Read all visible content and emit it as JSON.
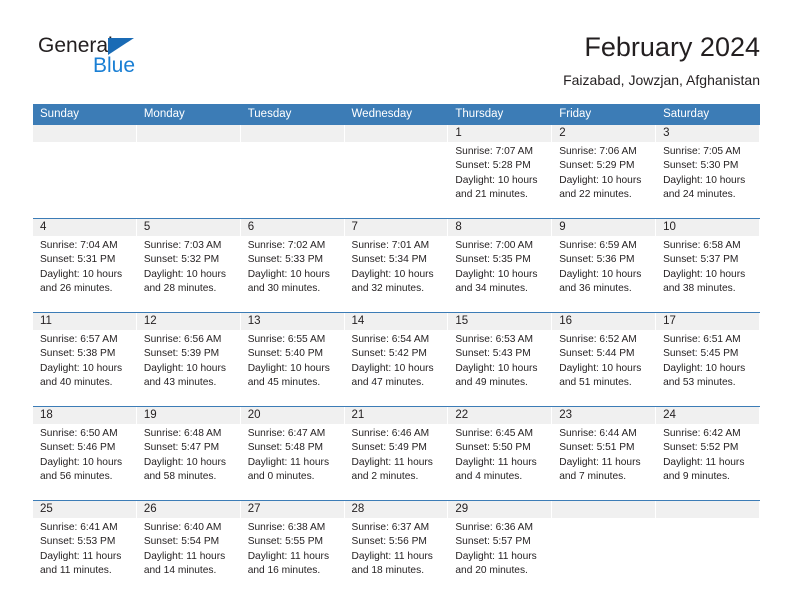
{
  "brand": {
    "name_part1": "General",
    "name_part2": "Blue",
    "triangle_color": "#1a6bb5",
    "blue_color": "#1a7fd4"
  },
  "header": {
    "title": "February 2024",
    "location": "Faizabad, Jowzjan, Afghanistan"
  },
  "theme": {
    "header_blue": "#3c7cb6",
    "daynum_gray": "#f0f0f0",
    "text": "#231f20"
  },
  "weekdays": [
    "Sunday",
    "Monday",
    "Tuesday",
    "Wednesday",
    "Thursday",
    "Friday",
    "Saturday"
  ],
  "weeks": [
    [
      {
        "day": "",
        "sunrise": "",
        "sunset": "",
        "daylight1": "",
        "daylight2": ""
      },
      {
        "day": "",
        "sunrise": "",
        "sunset": "",
        "daylight1": "",
        "daylight2": ""
      },
      {
        "day": "",
        "sunrise": "",
        "sunset": "",
        "daylight1": "",
        "daylight2": ""
      },
      {
        "day": "",
        "sunrise": "",
        "sunset": "",
        "daylight1": "",
        "daylight2": ""
      },
      {
        "day": "1",
        "sunrise": "Sunrise: 7:07 AM",
        "sunset": "Sunset: 5:28 PM",
        "daylight1": "Daylight: 10 hours",
        "daylight2": "and 21 minutes."
      },
      {
        "day": "2",
        "sunrise": "Sunrise: 7:06 AM",
        "sunset": "Sunset: 5:29 PM",
        "daylight1": "Daylight: 10 hours",
        "daylight2": "and 22 minutes."
      },
      {
        "day": "3",
        "sunrise": "Sunrise: 7:05 AM",
        "sunset": "Sunset: 5:30 PM",
        "daylight1": "Daylight: 10 hours",
        "daylight2": "and 24 minutes."
      }
    ],
    [
      {
        "day": "4",
        "sunrise": "Sunrise: 7:04 AM",
        "sunset": "Sunset: 5:31 PM",
        "daylight1": "Daylight: 10 hours",
        "daylight2": "and 26 minutes."
      },
      {
        "day": "5",
        "sunrise": "Sunrise: 7:03 AM",
        "sunset": "Sunset: 5:32 PM",
        "daylight1": "Daylight: 10 hours",
        "daylight2": "and 28 minutes."
      },
      {
        "day": "6",
        "sunrise": "Sunrise: 7:02 AM",
        "sunset": "Sunset: 5:33 PM",
        "daylight1": "Daylight: 10 hours",
        "daylight2": "and 30 minutes."
      },
      {
        "day": "7",
        "sunrise": "Sunrise: 7:01 AM",
        "sunset": "Sunset: 5:34 PM",
        "daylight1": "Daylight: 10 hours",
        "daylight2": "and 32 minutes."
      },
      {
        "day": "8",
        "sunrise": "Sunrise: 7:00 AM",
        "sunset": "Sunset: 5:35 PM",
        "daylight1": "Daylight: 10 hours",
        "daylight2": "and 34 minutes."
      },
      {
        "day": "9",
        "sunrise": "Sunrise: 6:59 AM",
        "sunset": "Sunset: 5:36 PM",
        "daylight1": "Daylight: 10 hours",
        "daylight2": "and 36 minutes."
      },
      {
        "day": "10",
        "sunrise": "Sunrise: 6:58 AM",
        "sunset": "Sunset: 5:37 PM",
        "daylight1": "Daylight: 10 hours",
        "daylight2": "and 38 minutes."
      }
    ],
    [
      {
        "day": "11",
        "sunrise": "Sunrise: 6:57 AM",
        "sunset": "Sunset: 5:38 PM",
        "daylight1": "Daylight: 10 hours",
        "daylight2": "and 40 minutes."
      },
      {
        "day": "12",
        "sunrise": "Sunrise: 6:56 AM",
        "sunset": "Sunset: 5:39 PM",
        "daylight1": "Daylight: 10 hours",
        "daylight2": "and 43 minutes."
      },
      {
        "day": "13",
        "sunrise": "Sunrise: 6:55 AM",
        "sunset": "Sunset: 5:40 PM",
        "daylight1": "Daylight: 10 hours",
        "daylight2": "and 45 minutes."
      },
      {
        "day": "14",
        "sunrise": "Sunrise: 6:54 AM",
        "sunset": "Sunset: 5:42 PM",
        "daylight1": "Daylight: 10 hours",
        "daylight2": "and 47 minutes."
      },
      {
        "day": "15",
        "sunrise": "Sunrise: 6:53 AM",
        "sunset": "Sunset: 5:43 PM",
        "daylight1": "Daylight: 10 hours",
        "daylight2": "and 49 minutes."
      },
      {
        "day": "16",
        "sunrise": "Sunrise: 6:52 AM",
        "sunset": "Sunset: 5:44 PM",
        "daylight1": "Daylight: 10 hours",
        "daylight2": "and 51 minutes."
      },
      {
        "day": "17",
        "sunrise": "Sunrise: 6:51 AM",
        "sunset": "Sunset: 5:45 PM",
        "daylight1": "Daylight: 10 hours",
        "daylight2": "and 53 minutes."
      }
    ],
    [
      {
        "day": "18",
        "sunrise": "Sunrise: 6:50 AM",
        "sunset": "Sunset: 5:46 PM",
        "daylight1": "Daylight: 10 hours",
        "daylight2": "and 56 minutes."
      },
      {
        "day": "19",
        "sunrise": "Sunrise: 6:48 AM",
        "sunset": "Sunset: 5:47 PM",
        "daylight1": "Daylight: 10 hours",
        "daylight2": "and 58 minutes."
      },
      {
        "day": "20",
        "sunrise": "Sunrise: 6:47 AM",
        "sunset": "Sunset: 5:48 PM",
        "daylight1": "Daylight: 11 hours",
        "daylight2": "and 0 minutes."
      },
      {
        "day": "21",
        "sunrise": "Sunrise: 6:46 AM",
        "sunset": "Sunset: 5:49 PM",
        "daylight1": "Daylight: 11 hours",
        "daylight2": "and 2 minutes."
      },
      {
        "day": "22",
        "sunrise": "Sunrise: 6:45 AM",
        "sunset": "Sunset: 5:50 PM",
        "daylight1": "Daylight: 11 hours",
        "daylight2": "and 4 minutes."
      },
      {
        "day": "23",
        "sunrise": "Sunrise: 6:44 AM",
        "sunset": "Sunset: 5:51 PM",
        "daylight1": "Daylight: 11 hours",
        "daylight2": "and 7 minutes."
      },
      {
        "day": "24",
        "sunrise": "Sunrise: 6:42 AM",
        "sunset": "Sunset: 5:52 PM",
        "daylight1": "Daylight: 11 hours",
        "daylight2": "and 9 minutes."
      }
    ],
    [
      {
        "day": "25",
        "sunrise": "Sunrise: 6:41 AM",
        "sunset": "Sunset: 5:53 PM",
        "daylight1": "Daylight: 11 hours",
        "daylight2": "and 11 minutes."
      },
      {
        "day": "26",
        "sunrise": "Sunrise: 6:40 AM",
        "sunset": "Sunset: 5:54 PM",
        "daylight1": "Daylight: 11 hours",
        "daylight2": "and 14 minutes."
      },
      {
        "day": "27",
        "sunrise": "Sunrise: 6:38 AM",
        "sunset": "Sunset: 5:55 PM",
        "daylight1": "Daylight: 11 hours",
        "daylight2": "and 16 minutes."
      },
      {
        "day": "28",
        "sunrise": "Sunrise: 6:37 AM",
        "sunset": "Sunset: 5:56 PM",
        "daylight1": "Daylight: 11 hours",
        "daylight2": "and 18 minutes."
      },
      {
        "day": "29",
        "sunrise": "Sunrise: 6:36 AM",
        "sunset": "Sunset: 5:57 PM",
        "daylight1": "Daylight: 11 hours",
        "daylight2": "and 20 minutes."
      },
      {
        "day": "",
        "sunrise": "",
        "sunset": "",
        "daylight1": "",
        "daylight2": ""
      },
      {
        "day": "",
        "sunrise": "",
        "sunset": "",
        "daylight1": "",
        "daylight2": ""
      }
    ]
  ]
}
